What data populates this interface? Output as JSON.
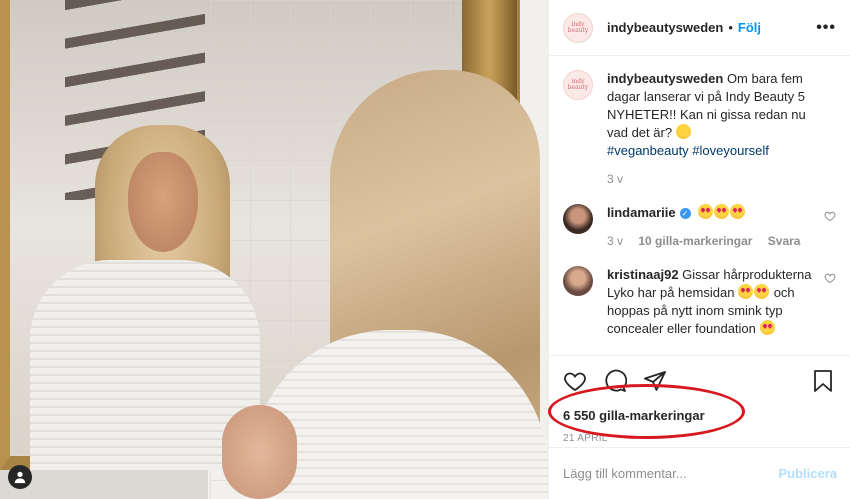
{
  "post": {
    "username": "indybeautysweden",
    "follow_label": "Följ",
    "more_label": "•••",
    "avatar_text": "indy beauty"
  },
  "caption": {
    "username": "indybeautysweden",
    "text": "Om bara fem dagar lanserar vi på Indy Beauty 5 NYHETER!! Kan ni gissa redan nu vad det är?",
    "hashtags": "#veganbeauty #loveyourself",
    "time": "3 v"
  },
  "comments": [
    {
      "username": "lindamariie",
      "verified": true,
      "text": "",
      "time": "3 v",
      "likes": "10 gilla-markeringar",
      "reply": "Svara"
    },
    {
      "username": "kristinaaj92",
      "text_1": "Gissar hårprodukterna Lyko har på hemsidan",
      "text_2": "och hoppas på nytt inom smink typ concealer eller foundation"
    }
  ],
  "likes_count": "6 550 gilla-markeringar",
  "date": "21 april",
  "add_comment": {
    "placeholder": "Lägg till kommentar...",
    "publish_label": "Publicera"
  },
  "colors": {
    "link_blue": "#0095f6",
    "highlight_red": "#d7191f",
    "publish_disabled": "#b2dffc"
  }
}
